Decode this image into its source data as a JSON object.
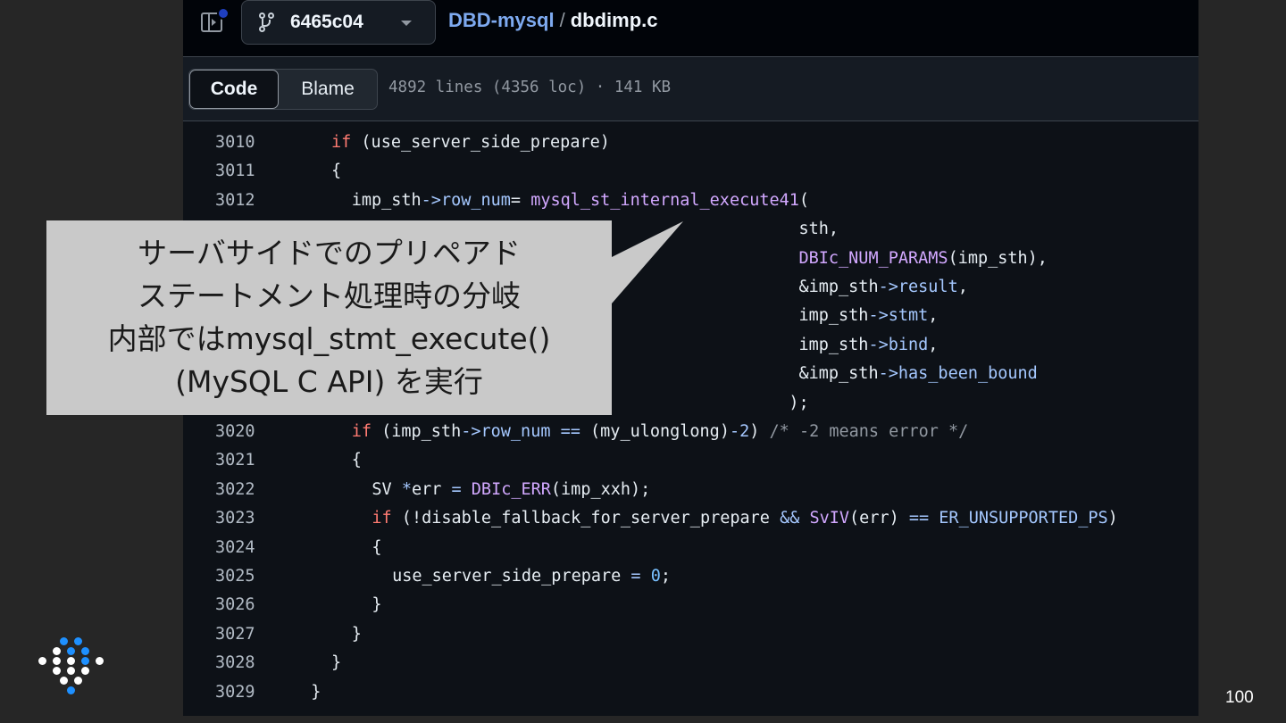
{
  "header": {
    "branch": "6465c04",
    "repo": "DBD-mysql",
    "separator": "/",
    "file": "dbdimp.c"
  },
  "file_header": {
    "tabs": [
      {
        "label": "Code",
        "selected": true
      },
      {
        "label": "Blame",
        "selected": false
      }
    ],
    "meta": "4892 lines (4356 loc) · 141 KB"
  },
  "code": {
    "lines": [
      {
        "n": "3010",
        "indent": 2,
        "tokens": [
          {
            "t": "if",
            "c": "kw"
          },
          {
            "t": " (use_server_side_prepare)",
            "c": ""
          }
        ]
      },
      {
        "n": "3011",
        "indent": 2,
        "tokens": [
          {
            "t": "{",
            "c": ""
          }
        ]
      },
      {
        "n": "3012",
        "indent": 3,
        "tokens": [
          {
            "t": "imp_sth",
            "c": ""
          },
          {
            "t": "->",
            "c": "ac"
          },
          {
            "t": "row_num",
            "c": "ac"
          },
          {
            "t": "= ",
            "c": ""
          },
          {
            "t": "mysql_st_internal_execute41",
            "c": "fn"
          },
          {
            "t": "(",
            "c": ""
          }
        ]
      },
      {
        "n": "",
        "indent": 0,
        "tokens": [
          {
            "t": "                                               sth,",
            "c": ""
          }
        ]
      },
      {
        "n": "",
        "indent": 0,
        "tokens": [
          {
            "t": "                                               ",
            "c": ""
          },
          {
            "t": "DBIc_NUM_PARAMS",
            "c": "fn"
          },
          {
            "t": "(imp_sth),",
            "c": ""
          }
        ]
      },
      {
        "n": "",
        "indent": 0,
        "tokens": [
          {
            "t": "                                               &imp_sth",
            "c": ""
          },
          {
            "t": "->",
            "c": "ac"
          },
          {
            "t": "result",
            "c": "ac"
          },
          {
            "t": ",",
            "c": ""
          }
        ]
      },
      {
        "n": "",
        "indent": 0,
        "tokens": [
          {
            "t": "                                               imp_sth",
            "c": ""
          },
          {
            "t": "->",
            "c": "ac"
          },
          {
            "t": "stmt",
            "c": "ac"
          },
          {
            "t": ",",
            "c": ""
          }
        ]
      },
      {
        "n": "",
        "indent": 0,
        "tokens": [
          {
            "t": "                                               imp_sth",
            "c": ""
          },
          {
            "t": "->",
            "c": "ac"
          },
          {
            "t": "bind",
            "c": "ac"
          },
          {
            "t": ",",
            "c": ""
          }
        ]
      },
      {
        "n": "",
        "indent": 0,
        "tokens": [
          {
            "t": "                                               &imp_sth",
            "c": ""
          },
          {
            "t": "->",
            "c": "ac"
          },
          {
            "t": "has_been_bound",
            "c": "ac"
          }
        ]
      },
      {
        "n": "",
        "indent": 0,
        "tokens": [
          {
            "t": "                                              );",
            "c": ""
          }
        ]
      },
      {
        "n": "3020",
        "indent": 3,
        "tokens": [
          {
            "t": "if",
            "c": "kw"
          },
          {
            "t": " (imp_sth",
            "c": ""
          },
          {
            "t": "->",
            "c": "ac"
          },
          {
            "t": "row_num",
            "c": "ac"
          },
          {
            "t": " ",
            "c": ""
          },
          {
            "t": "==",
            "c": "ac"
          },
          {
            "t": " (my_ulonglong)",
            "c": ""
          },
          {
            "t": "-2",
            "c": "ac"
          },
          {
            "t": ") ",
            "c": ""
          },
          {
            "t": "/* -2 means error */",
            "c": "cm"
          }
        ]
      },
      {
        "n": "3021",
        "indent": 3,
        "tokens": [
          {
            "t": "{",
            "c": ""
          }
        ]
      },
      {
        "n": "3022",
        "indent": 4,
        "tokens": [
          {
            "t": "SV ",
            "c": ""
          },
          {
            "t": "*",
            "c": "ac"
          },
          {
            "t": "err ",
            "c": ""
          },
          {
            "t": "=",
            "c": "ac"
          },
          {
            "t": " ",
            "c": ""
          },
          {
            "t": "DBIc_ERR",
            "c": "fn"
          },
          {
            "t": "(imp_xxh);",
            "c": ""
          }
        ]
      },
      {
        "n": "3023",
        "indent": 4,
        "tokens": [
          {
            "t": "if",
            "c": "kw"
          },
          {
            "t": " (!disable_fallback_for_server_prepare ",
            "c": ""
          },
          {
            "t": "&&",
            "c": "ac"
          },
          {
            "t": " ",
            "c": ""
          },
          {
            "t": "SvIV",
            "c": "fn"
          },
          {
            "t": "(err) ",
            "c": ""
          },
          {
            "t": "==",
            "c": "ac"
          },
          {
            "t": " ",
            "c": ""
          },
          {
            "t": "ER_UNSUPPORTED_PS",
            "c": "ac"
          },
          {
            "t": ")",
            "c": ""
          }
        ]
      },
      {
        "n": "3024",
        "indent": 4,
        "tokens": [
          {
            "t": "{",
            "c": ""
          }
        ]
      },
      {
        "n": "3025",
        "indent": 5,
        "tokens": [
          {
            "t": "use_server_side_prepare ",
            "c": ""
          },
          {
            "t": "=",
            "c": "ac"
          },
          {
            "t": " ",
            "c": ""
          },
          {
            "t": "0",
            "c": "num"
          },
          {
            "t": ";",
            "c": ""
          }
        ]
      },
      {
        "n": "3026",
        "indent": 4,
        "tokens": [
          {
            "t": "}",
            "c": ""
          }
        ]
      },
      {
        "n": "3027",
        "indent": 3,
        "tokens": [
          {
            "t": "}",
            "c": ""
          }
        ]
      },
      {
        "n": "3028",
        "indent": 2,
        "tokens": [
          {
            "t": "}",
            "c": ""
          }
        ]
      },
      {
        "n": "3029",
        "indent": 1,
        "tokens": [
          {
            "t": "}",
            "c": ""
          }
        ]
      }
    ]
  },
  "callout": {
    "lines": [
      "サーバサイドでのプリペアド",
      "ステートメント処理時の分岐",
      "内部ではmysql_stmt_execute()",
      "(MySQL C API) を実行"
    ]
  },
  "page_number": "100",
  "colors": {
    "keyword": "#ff7b72",
    "function": "#d2a8ff",
    "accent": "#a5c8ff",
    "comment": "#9198a1",
    "logo_blue": "#1e90ff",
    "logo_white": "#ffffff"
  }
}
